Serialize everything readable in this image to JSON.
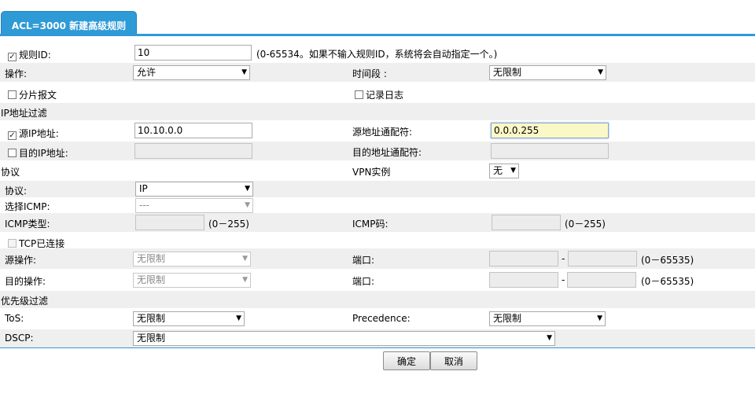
{
  "tab": {
    "title": "ACL=3000 新建高级规则"
  },
  "rule_id": {
    "label": "规则ID:",
    "value": "10",
    "hint": "(0-65534。如果不输入规则ID，系统将会自动指定一个。)"
  },
  "action": {
    "label": "操作:",
    "value": "允许"
  },
  "time_range": {
    "label": "时间段 :",
    "value": "无限制"
  },
  "fragment": {
    "label": "分片报文"
  },
  "log": {
    "label": "记录日志"
  },
  "ip_filter": {
    "title": "IP地址过滤"
  },
  "src_ip": {
    "label": "源IP地址:",
    "value": "10.10.0.0"
  },
  "src_wildcard": {
    "label": "源地址通配符:",
    "value": "0.0.0.255"
  },
  "dst_ip": {
    "label": "目的IP地址:",
    "value": ""
  },
  "dst_wildcard": {
    "label": "目的地址通配符:",
    "value": ""
  },
  "protocol_section": {
    "title": "协议"
  },
  "vpn": {
    "label": "VPN实例",
    "value": "无"
  },
  "protocol": {
    "label": "协议:",
    "value": "IP"
  },
  "icmp_select": {
    "label": "选择ICMP:",
    "value": "---"
  },
  "icmp_type": {
    "label": "ICMP类型:",
    "value": "",
    "hint": "(0－255)"
  },
  "icmp_code": {
    "label": "ICMP码:",
    "value": "",
    "hint": "(0－255)"
  },
  "tcp_established": {
    "label": "TCP已连接"
  },
  "src_port_op": {
    "label": "源操作:",
    "value": "无限制"
  },
  "src_port": {
    "label": "端口:",
    "from": "",
    "sep": "-",
    "to": "",
    "hint": "(0－65535)"
  },
  "dst_port_op": {
    "label": "目的操作:",
    "value": "无限制"
  },
  "dst_port": {
    "label": "端口:",
    "from": "",
    "sep": "-",
    "to": "",
    "hint": "(0－65535)"
  },
  "priority_filter": {
    "title": "优先级过滤"
  },
  "tos": {
    "label": "ToS:",
    "value": "无限制"
  },
  "precedence": {
    "label": "Precedence:",
    "value": "无限制"
  },
  "dscp": {
    "label": "DSCP:",
    "value": "无限制"
  },
  "buttons": {
    "ok": "确定",
    "cancel": "取消"
  },
  "icons": {
    "checked": "✓",
    "dropdown": "▼"
  },
  "colors": {
    "accent": "#2e9ad6",
    "row_shade": "#efefef",
    "highlight_input": "#fbf8c8"
  }
}
